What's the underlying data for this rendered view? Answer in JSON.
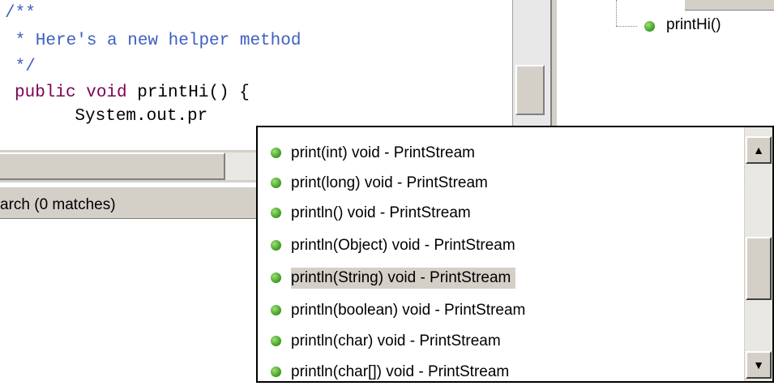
{
  "editor": {
    "lines": [
      {
        "text": "/**",
        "kind": "comment"
      },
      {
        "text": " * Here's a new helper method",
        "kind": "comment"
      },
      {
        "text": " */",
        "kind": "comment"
      },
      {
        "text_kw": "public void",
        "text_rest": " printHi() {",
        "kind": "code"
      },
      {
        "text": "    System.out.pr",
        "kind": "plain"
      }
    ]
  },
  "outline": {
    "method_label": "printHi()",
    "method_icon": "green-circle-public-method-icon"
  },
  "search_tab": {
    "label": "arch (0 matches)"
  },
  "completion": {
    "items": [
      {
        "label": "print(int)   void - PrintStream"
      },
      {
        "label": "print(long)   void - PrintStream"
      },
      {
        "label": "println()   void - PrintStream"
      },
      {
        "label": "println(Object)   void - PrintStream"
      },
      {
        "label": "println(String)   void - PrintStream"
      },
      {
        "label": "println(boolean)   void - PrintStream"
      },
      {
        "label": "println(char)   void - PrintStream"
      },
      {
        "label": "println(char[])   void - PrintStream"
      }
    ],
    "selected_item": "println(String)   void - PrintStream",
    "scroll_up_icon": "arrow-up-icon",
    "scroll_down_icon": "arrow-down-icon",
    "scroll_up_glyph": "▲",
    "scroll_down_glyph": "▼"
  },
  "colors": {
    "comment": "#3f5fbf",
    "keyword": "#7f0055",
    "selection": "#d4d0c8",
    "method_icon": "#3a9a1a"
  }
}
